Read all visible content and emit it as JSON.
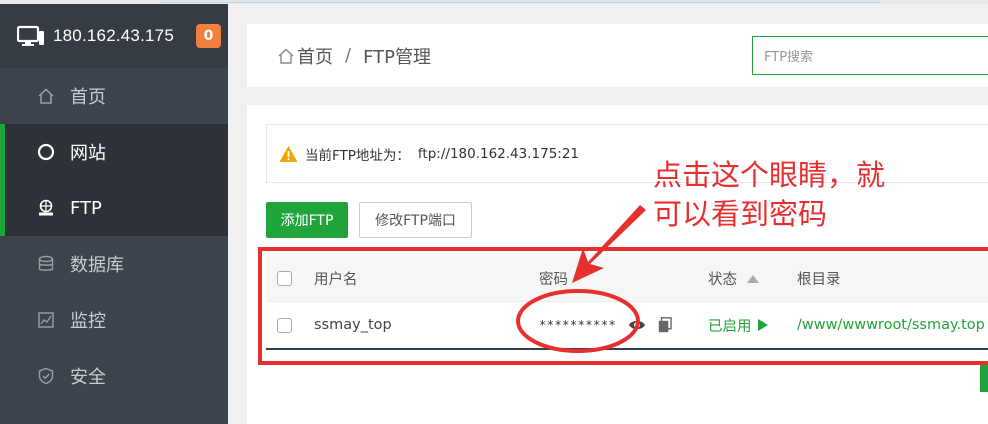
{
  "sidebar": {
    "server_ip": "180.162.43.175",
    "badge_count": "0",
    "items": [
      {
        "label": "首页",
        "icon": "home-icon",
        "active": false
      },
      {
        "label": "网站",
        "icon": "globe-icon",
        "active": true
      },
      {
        "label": "FTP",
        "icon": "ftp-icon",
        "active": true
      },
      {
        "label": "数据库",
        "icon": "database-icon",
        "active": false
      },
      {
        "label": "监控",
        "icon": "monitor-chart-icon",
        "active": false
      },
      {
        "label": "安全",
        "icon": "shield-icon",
        "active": false
      }
    ]
  },
  "header": {
    "breadcrumb_home": "首页",
    "breadcrumb_sep": "/",
    "breadcrumb_current": "FTP管理",
    "search_placeholder": "FTP搜索"
  },
  "notice": {
    "label": "当前FTP地址为：",
    "address": "ftp://180.162.43.175:21"
  },
  "toolbar": {
    "add_label": "添加FTP",
    "port_label": "修改FTP端口"
  },
  "table": {
    "columns": {
      "username": "用户名",
      "password": "密码",
      "status": "状态",
      "root": "根目录"
    },
    "rows": [
      {
        "username": "ssmay_top",
        "password": "**********",
        "status": "已启用",
        "root": "/www/wwwroot/ssmay.top"
      }
    ]
  },
  "annotation": {
    "line1": "点击这个眼睛，就",
    "line2": "可以看到密码"
  },
  "colors": {
    "accent": "#20a53a",
    "sidebar_bg": "#3c444d",
    "annotation_red": "#e63030",
    "badge": "#f0803c"
  }
}
